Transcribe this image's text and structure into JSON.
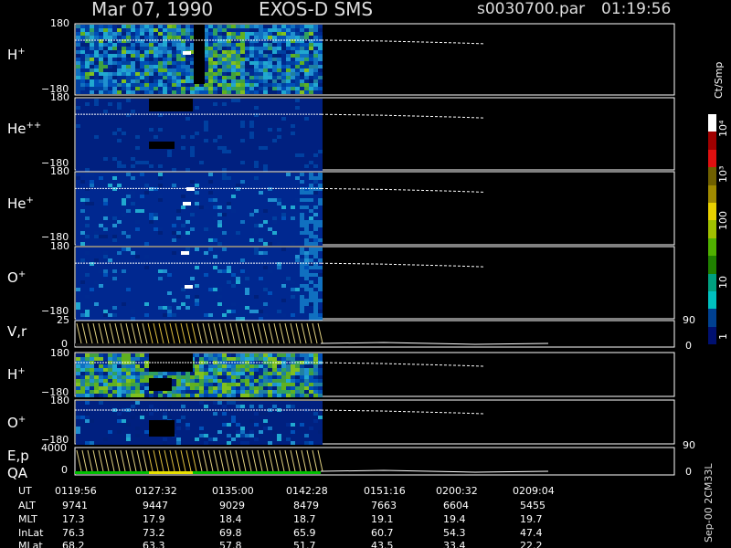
{
  "header": {
    "date": "Mar 07, 1990",
    "instrument": "EXOS-D SMS",
    "file": "s0030700.par",
    "time": "01:19:56"
  },
  "panels": [
    {
      "label": "H",
      "sup": "+",
      "top_tick": "180",
      "bottom_tick": "−180"
    },
    {
      "label": "He",
      "sup": "++",
      "top_tick": "180",
      "bottom_tick": "−180"
    },
    {
      "label": "He",
      "sup": "+",
      "top_tick": "180",
      "bottom_tick": "−180"
    },
    {
      "label": "O",
      "sup": "+",
      "top_tick": "180",
      "bottom_tick": "−180"
    },
    {
      "label": "V,r",
      "sup": "",
      "top_tick": "25",
      "bottom_tick": "0",
      "right_top": "90",
      "right_bottom": "0"
    },
    {
      "label": "H",
      "sup": "+",
      "top_tick": "180",
      "bottom_tick": "−180"
    },
    {
      "label": "O",
      "sup": "+",
      "top_tick": "180",
      "bottom_tick": "−180"
    },
    {
      "label": "E,p",
      "sup": "",
      "label2": "QA",
      "top_tick": "4000",
      "bottom_tick": "0",
      "right_top": "90",
      "right_bottom": "0"
    }
  ],
  "colorbar": {
    "unit": "Ct/Smp",
    "ticks": [
      "10⁴",
      "10³",
      "100",
      "10",
      "1"
    ],
    "colors": [
      "#ffffff",
      "#a00000",
      "#e01010",
      "#706000",
      "#a08a00",
      "#e8d000",
      "#a0c000",
      "#50b000",
      "#208000",
      "#00a080",
      "#00c0c0",
      "#004090",
      "#001070"
    ]
  },
  "side_label": "Sep-00 2CM33L",
  "footer": {
    "row_labels": [
      "UT",
      "ALT",
      "MLT",
      "InLat",
      "MLat"
    ],
    "columns": [
      [
        "0119:56",
        "9741",
        "17.3",
        "76.3",
        "68.2"
      ],
      [
        "0127:32",
        "9447",
        "17.9",
        "73.2",
        "63.3"
      ],
      [
        "0135:00",
        "9029",
        "18.4",
        "69.8",
        "57.8"
      ],
      [
        "0142:28",
        "8479",
        "18.7",
        "65.9",
        "51.7"
      ],
      [
        "0151:16",
        "7663",
        "19.1",
        "60.7",
        "43.5"
      ],
      [
        "0200:32",
        "6604",
        "19.4",
        "54.3",
        "33.4"
      ],
      [
        "0209:04",
        "5455",
        "19.7",
        "47.4",
        "22.2"
      ]
    ]
  },
  "chart_data": {
    "type": "heatmap",
    "title": "Mar 07, 1990   EXOS-D SMS",
    "x_tick_labels": [
      "0119:56",
      "0127:32",
      "0135:00",
      "0142:28",
      "0151:16",
      "0200:32",
      "0209:04"
    ],
    "panels": [
      "H+",
      "He++",
      "He+",
      "O+",
      "V,r",
      "H+",
      "O+",
      "E,p"
    ],
    "angle_range": [
      -180,
      180
    ],
    "colorbar_range": [
      1,
      10000
    ],
    "colorbar_scale": "log",
    "colorbar_unit": "Ct/Smp"
  }
}
